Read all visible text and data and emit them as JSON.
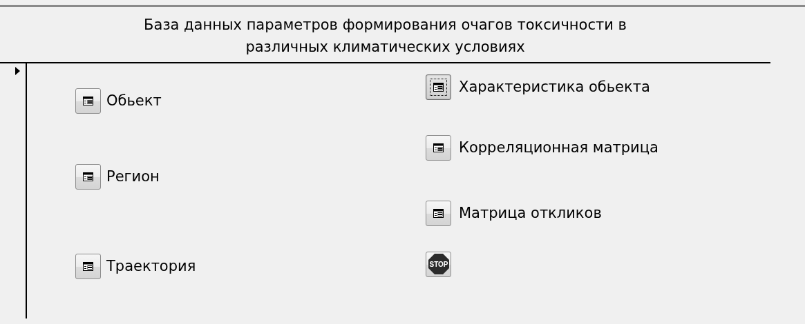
{
  "form": {
    "title": "База данных параметров формирования очагов токсичности в различных климатических условиях"
  },
  "left_buttons": [
    {
      "kind": "form",
      "label": "Обьект",
      "focused": false
    },
    {
      "kind": "form",
      "label": "Регион",
      "focused": false
    },
    {
      "kind": "form",
      "label": "Траектория",
      "focused": false
    }
  ],
  "right_buttons": [
    {
      "kind": "form",
      "label": "Характеристика обьекта",
      "focused": true
    },
    {
      "kind": "form",
      "label": "Корреляционная матрица",
      "focused": false
    },
    {
      "kind": "form",
      "label": "Матрица откликов",
      "focused": false
    },
    {
      "kind": "stop",
      "label": "STOP",
      "focused": false
    }
  ]
}
